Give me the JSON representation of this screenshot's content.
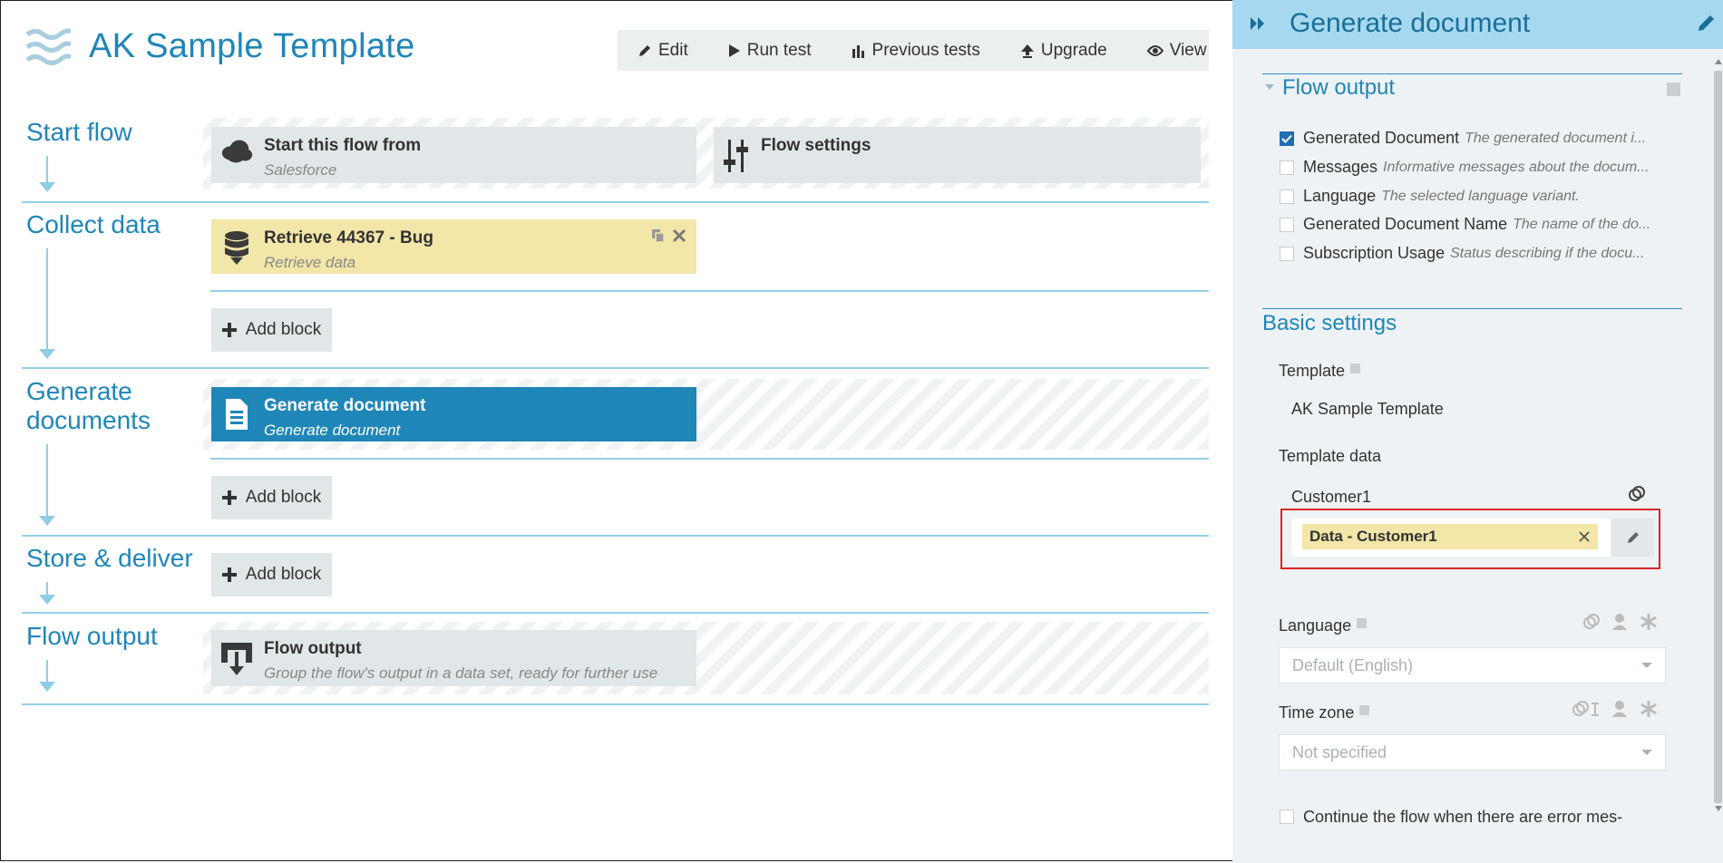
{
  "app": {
    "title": "AK Sample Template"
  },
  "toolbar": {
    "edit": "Edit",
    "run_test": "Run test",
    "previous_tests": "Previous tests",
    "upgrade": "Upgrade",
    "view": "View"
  },
  "sections": {
    "start_flow": "Start flow",
    "collect_data": "Collect data",
    "generate_documents": "Generate documents",
    "store_deliver": "Store & deliver",
    "flow_output": "Flow output"
  },
  "blocks": {
    "start": {
      "title": "Start this flow from",
      "subtitle": "Salesforce",
      "icon": "cloud-icon"
    },
    "settings": {
      "title": "Flow settings",
      "icon": "sliders-icon"
    },
    "retrieve": {
      "title": "Retrieve 44367 - Bug",
      "subtitle": "Retrieve data",
      "icon": "database-icon"
    },
    "generate": {
      "title": "Generate document",
      "subtitle": "Generate document",
      "icon": "document-icon"
    },
    "output": {
      "title": "Flow output",
      "subtitle": "Group the flow's output in a data set, ready for further use",
      "icon": "output-icon"
    },
    "add_block": "Add block"
  },
  "panel": {
    "title": "Generate document",
    "flow_output_title": "Flow output",
    "outputs": [
      {
        "name": "Generated Document",
        "desc": "The generated document i...",
        "checked": true
      },
      {
        "name": "Messages",
        "desc": "Informative messages about the docum...",
        "checked": false
      },
      {
        "name": "Language",
        "desc": "The selected language variant.",
        "checked": false
      },
      {
        "name": "Generated Document Name",
        "desc": "The name of the do...",
        "checked": false
      },
      {
        "name": "Subscription Usage",
        "desc": "Status describing if the docu...",
        "checked": false
      }
    ],
    "basic_settings_title": "Basic settings",
    "template_label": "Template",
    "template_value": "AK Sample Template",
    "template_data_label": "Template data",
    "customer_label": "Customer1",
    "customer_chip": "Data - Customer1",
    "language_label": "Language",
    "language_value": "Default (English)",
    "timezone_label": "Time zone",
    "timezone_value": "Not specified",
    "continue_label": "Continue the flow when there are error mes-"
  },
  "colors": {
    "accent": "#1f86b8",
    "panel_header": "#a6d9ef",
    "yellow_block": "#f2e6a8",
    "highlight_border": "#d9262b"
  }
}
